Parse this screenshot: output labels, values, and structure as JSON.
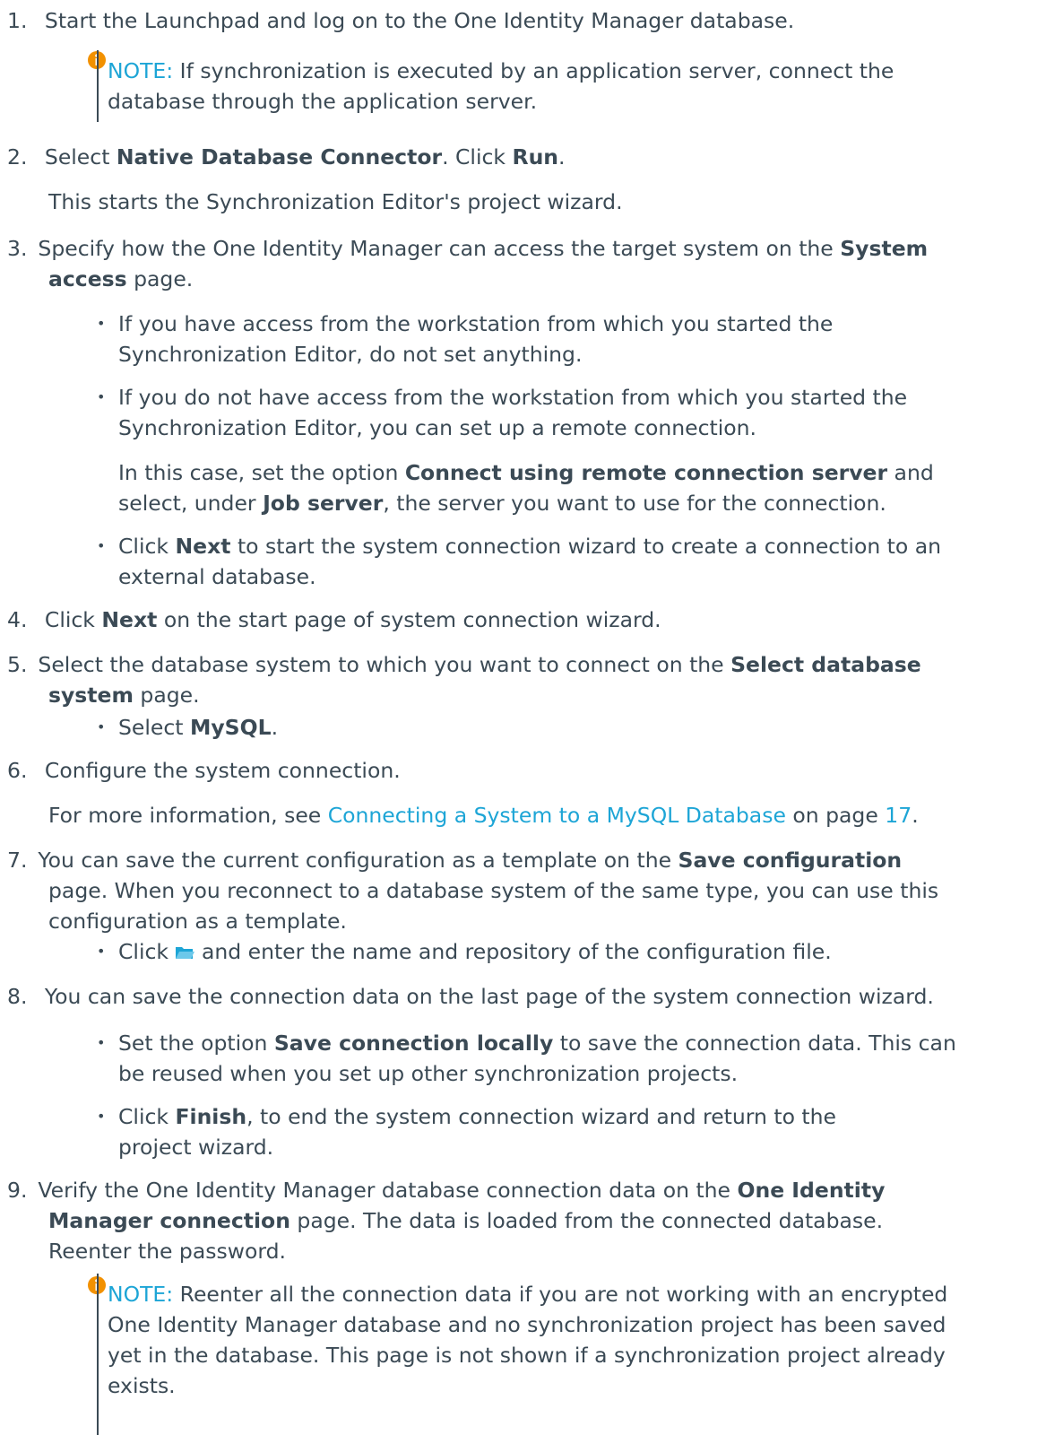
{
  "steps": {
    "s1": {
      "num": "1.",
      "text": "Start the Launchpad and log on to the One Identity Manager database."
    },
    "note1": {
      "label": "NOTE:",
      "l1": " If synchronization is executed by an application server, connect the",
      "l2": "database through the application server."
    },
    "s2": {
      "num": "2.",
      "a": "Select ",
      "b1": "Native Database Connector",
      "c": ". Click ",
      "b2": "Run",
      "d": ".",
      "sub": "This starts the Synchronization Editor's project wizard."
    },
    "s3": {
      "num": "3.",
      "l1a": "Specify how the One Identity Manager can access the target system on the ",
      "l1b": "System",
      "l2b": "access",
      "l2c": " page.",
      "bul1_l1": "If you have access from the workstation from which you started the",
      "bul1_l2": "Synchronization Editor, do not set anything.",
      "bul2_l1": "If you do not have access from the workstation from which you started the",
      "bul2_l2": "Synchronization Editor, you can set up a remote connection.",
      "p_l1a": "In this case, set the option ",
      "p_l1b": "Connect using remote connection server",
      "p_l1c": " and",
      "p_l2a": "select, under ",
      "p_l2b": "Job server",
      "p_l2c": ", the server you want to use for the connection.",
      "bul3_l1a": "Click ",
      "bul3_l1b": "Next",
      "bul3_l1c": " to start the system connection wizard to create a connection to an",
      "bul3_l2": "external database."
    },
    "s4": {
      "num": "4.",
      "a": "Click ",
      "b": "Next",
      "c": " on the start page of system connection wizard."
    },
    "s5": {
      "num": "5.",
      "l1a": "Select the database system to which you want to connect on the ",
      "l1b": "Select database",
      "l2b": "system",
      "l2c": " page.",
      "bul_a": "Select ",
      "bul_b": "MySQL",
      "bul_c": "."
    },
    "s6": {
      "num": "6.",
      "text": "Configure the system connection.",
      "sub_a": "For more information, see ",
      "sub_link": "Connecting a System to a MySQL Database",
      "sub_b": " on page ",
      "sub_page": "17",
      "sub_c": "."
    },
    "s7": {
      "num": "7.",
      "l1a": "You can save the current configuration as a template on the ",
      "l1b": "Save configuration",
      "l2": "page. When you reconnect to a database system of the same type, you can use this",
      "l3": "configuration as a template.",
      "bul_a": "Click ",
      "bul_b": " and enter the name and repository of the configuration file."
    },
    "s8": {
      "num": "8.",
      "text": "You can save the connection data on the last page of the system connection wizard.",
      "bul1_a": "Set the option ",
      "bul1_b": "Save connection locally",
      "bul1_c": " to save the connection data. This can",
      "bul1_l2": "be reused when you set up other synchronization projects.",
      "bul2_a": "Click ",
      "bul2_b": "Finish",
      "bul2_c": ", to end the system connection wizard and return to the",
      "bul2_l2": "project wizard."
    },
    "s9": {
      "num": "9.",
      "l1a": "Verify the One Identity Manager database connection data on the ",
      "l1b": "One Identity",
      "l2b": "Manager connection",
      "l2c": " page. The data is loaded from the connected database.",
      "l3": "Reenter the password."
    },
    "note2": {
      "label": "NOTE:",
      "l1": " Reenter all the connection data if you are not working with an encrypted",
      "l2": "One Identity Manager database and no synchronization project has been saved",
      "l3": "yet in the database. This page is not shown if a synchronization project already",
      "l4": "exists."
    }
  },
  "icons": {
    "note": "info-icon",
    "folder": "folder-open-icon"
  },
  "colors": {
    "text": "#3b4a55",
    "link": "#1da5d6",
    "note_icon": "#f29100",
    "folder": "#1da5d6"
  }
}
